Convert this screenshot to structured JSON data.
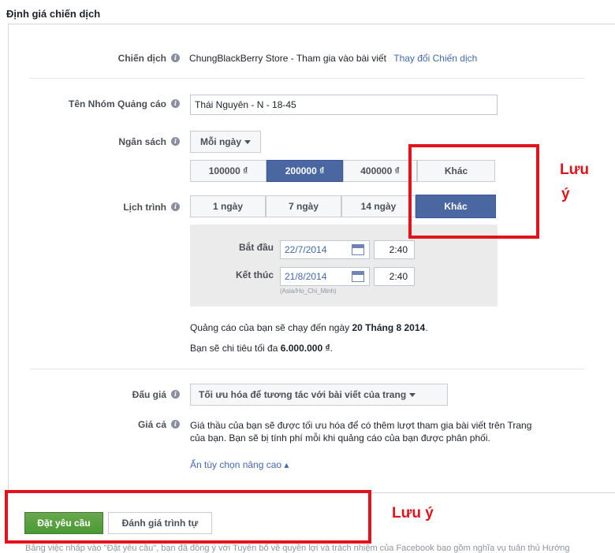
{
  "page_title": "Định giá chiến dịch",
  "campaign": {
    "label": "Chiến dịch",
    "value": "ChungBlackBerry Store - Tham gia vào bài viết",
    "change_link": "Thay đổi Chiến dịch"
  },
  "ad_group": {
    "label": "Tên Nhóm Quảng cáo",
    "value": "Thái Nguyên - N - 18-45"
  },
  "budget": {
    "label": "Ngân sách",
    "period_selected": "Mỗi ngày",
    "options": [
      "100000 ₫",
      "200000 ₫",
      "400000 ₫",
      "Khác"
    ],
    "selected_index": 1
  },
  "schedule": {
    "label": "Lịch trình",
    "options": [
      "1 ngày",
      "7 ngày",
      "14 ngày",
      "Khác"
    ],
    "selected_index": 3,
    "start_label": "Bắt đầu",
    "start_date": "22/7/2014",
    "start_time": "2:40",
    "end_label": "Kết thúc",
    "end_date": "21/8/2014",
    "end_time": "2:40",
    "timezone": "(Asia/Ho_Chi_Minh)"
  },
  "summary": {
    "run_prefix": "Quảng cáo của bạn sẽ chạy đến ngày ",
    "run_date": "20 Tháng 8 2014",
    "run_suffix": ".",
    "spend_prefix": "Bạn sẽ chi tiêu tối đa ",
    "spend_amount": "6.000.000 ₫",
    "spend_suffix": "."
  },
  "bidding": {
    "label": "Đấu giá",
    "value": "Tối ưu hóa để tương tác với bài viết của trang"
  },
  "pricing": {
    "label": "Giá cả",
    "line1": "Giá thầu của bạn sẽ được tối ưu hóa để có thêm lượt tham gia bài viết trên Trang",
    "line2": "của bạn. Bạn sẽ bị tính phí mỗi khi quảng cáo của bạn được phân phối.",
    "advanced_link": "Ẩn tùy chọn nâng cao ▴"
  },
  "buttons": {
    "place_order": "Đặt yêu cầu",
    "review": "Đánh giá trình tự"
  },
  "annotations": {
    "note_right_1": "Lưu",
    "note_right_2": "ý",
    "note_bottom": "Lưu ý"
  },
  "footer": {
    "text": "Bằng việc nhấp vào \"Đặt yêu cầu\", bạn đã đồng ý với Tuyên bố về quyền lợi và trách nhiệm của Facebook bao gồm nghĩa vụ tuân thủ Hướng"
  },
  "colors": {
    "selected_button": "#4b67a1",
    "green_button": "#4a9a35",
    "annotation_red": "#e3121b",
    "link_blue": "#4267b2"
  }
}
